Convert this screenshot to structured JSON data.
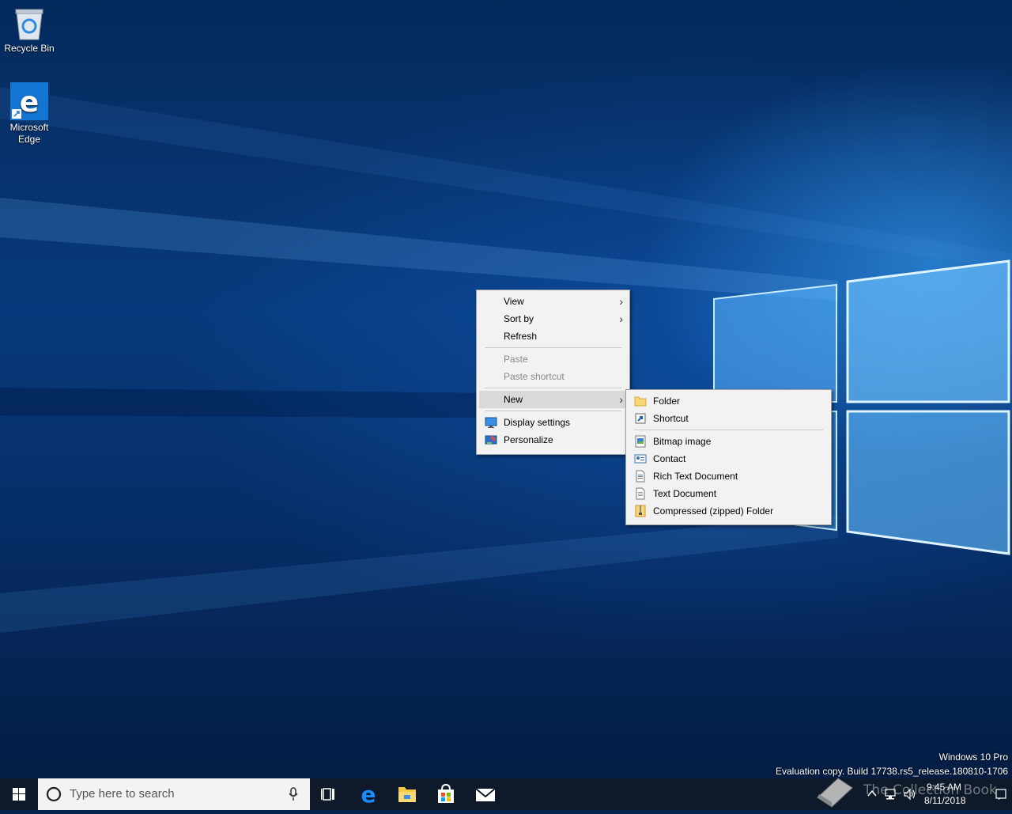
{
  "desktop_icons": {
    "recycle_bin": "Recycle Bin",
    "edge_line1": "Microsoft",
    "edge_line2": "Edge"
  },
  "context_menu": {
    "view": "View",
    "sort_by": "Sort by",
    "refresh": "Refresh",
    "paste": "Paste",
    "paste_shortcut": "Paste shortcut",
    "new": "New",
    "display_settings": "Display settings",
    "personalize": "Personalize"
  },
  "new_submenu": {
    "folder": "Folder",
    "shortcut": "Shortcut",
    "bitmap": "Bitmap image",
    "contact": "Contact",
    "rich_text": "Rich Text Document",
    "text_doc": "Text Document",
    "zip_folder": "Compressed (zipped) Folder"
  },
  "watermark": {
    "edition": "Windows 10 Pro",
    "build": "Evaluation copy. Build 17738.rs5_release.180810-1706"
  },
  "taskbar": {
    "search_placeholder": "Type here to search",
    "time": "9:45 AM",
    "date": "8/11/2018",
    "overlay_logo_text": "The Collection Book"
  },
  "colors": {
    "accent": "#0078d7",
    "taskbar_bg": "#0e1a29",
    "menu_bg": "#f2f2f2"
  }
}
